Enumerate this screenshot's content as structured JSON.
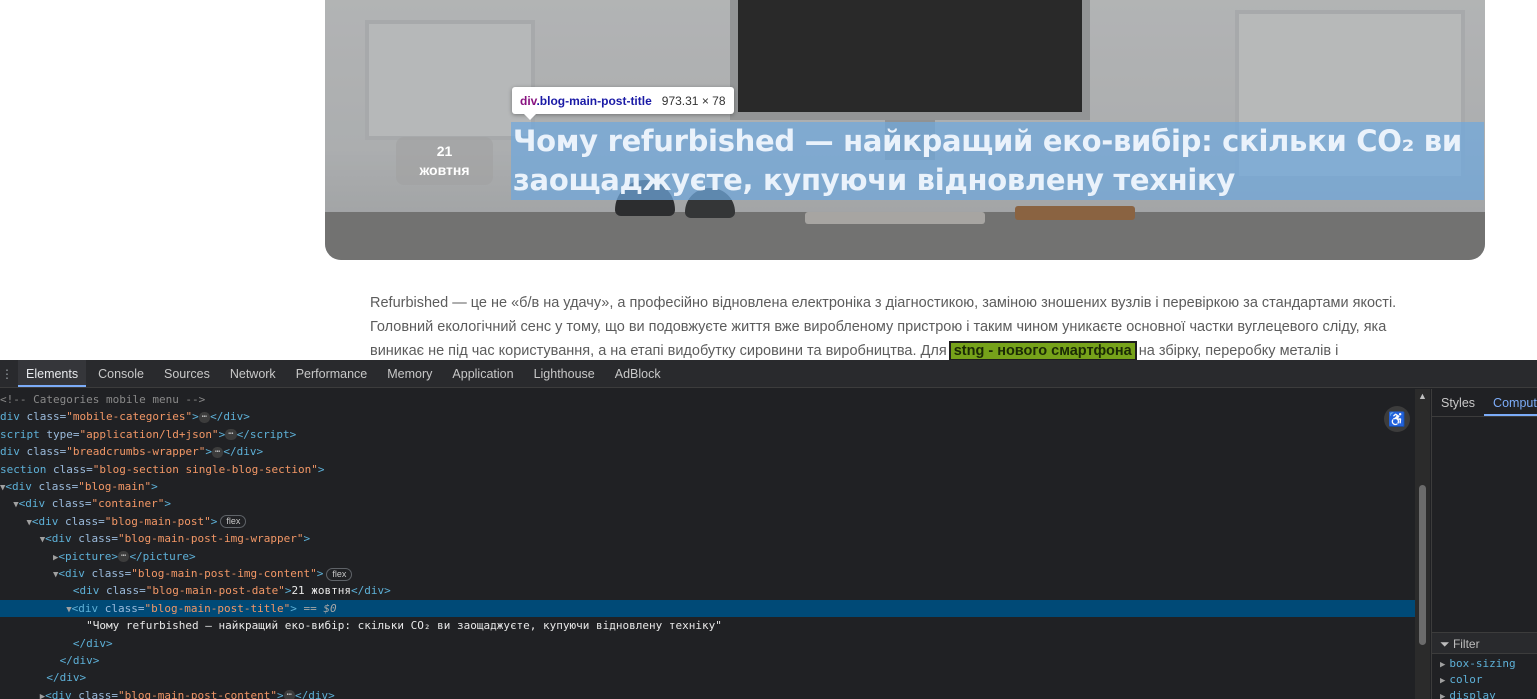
{
  "page": {
    "date_day": "21",
    "date_month": "жовтня",
    "post_title_line1": "Чому refurbished — найкращий еко-вибір: скільки CO₂ ви",
    "post_title_line2": "заощаджуєте, купуючи відновлену техніку",
    "tooltip": {
      "tag": "div",
      "class": ".blog-main-post-title",
      "dims": "973.31 × 78"
    },
    "article_line1": "Refurbished — це не «б/в на удачу», а професійно відновлена електроніка з діагностикою, заміною зношених вузлів і перевіркою за стандартами якості.",
    "article_line2": "Головний екологічний сенс у тому, що ви подовжуєте життя вже виробленому пристрою і таким чином уникаєте основної частки вуглецевого сліду, яка",
    "article_line3_before": "виникає не під час користування, а на етапі видобутку сировини та виробництва. Для ",
    "article_line3_highlight": "stng - нового смартфона",
    "article_line3_after": " на збірку, переробку металів і"
  },
  "devtools": {
    "tab_icon": "⋮",
    "tabs": [
      "Elements",
      "Console",
      "Sources",
      "Network",
      "Performance",
      "Memory",
      "Application",
      "Lighthouse",
      "AdBlock"
    ],
    "side_tabs": [
      "Styles",
      "Computed"
    ],
    "filter_placeholder": "Filter",
    "computed_props": [
      "box-sizing",
      "color",
      "display"
    ],
    "tree": {
      "comment": "-- Categories mobile menu -->",
      "r1_attr": "class",
      "r1_val": "\"mobile-categories\"",
      "r2_attr": "type",
      "r2_val": "\"application/ld+json\"",
      "r3_attr": "class",
      "r3_val": "\"breadcrumbs-wrapper\"",
      "r4_attr": "class",
      "r4_val": "\"blog-section single-blog-section\"",
      "r5_val": "\"blog-main\"",
      "r6_val": "\"container\"",
      "r7_val": "\"blog-main-post\"",
      "r8_val": "\"blog-main-post-img-wrapper\"",
      "r10_val": "\"blog-main-post-img-content\"",
      "r11_val": "\"blog-main-post-date\"",
      "r11_text": "21 жовтня",
      "r12_val": "\"blog-main-post-title\"",
      "r12_eq": " == $0",
      "r13_text": "\"Чому refurbished — найкращий еко-вибір: скільки CO₂ ви заощаджуєте, купуючи відновлену техніку\"",
      "r17_val": "\"blog-main-post-content\"",
      "flex": "flex",
      "dots": "⋯"
    }
  }
}
